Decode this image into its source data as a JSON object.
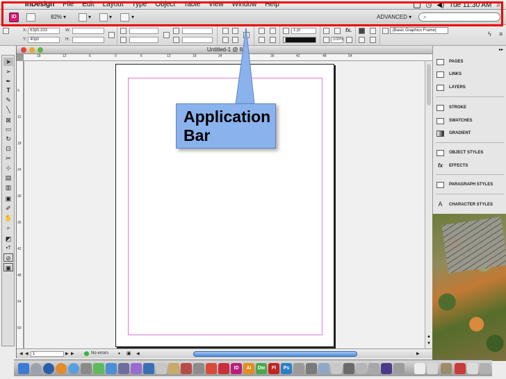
{
  "menubar": {
    "apple": "",
    "app_name": "InDesign",
    "menus": [
      "File",
      "Edit",
      "Layout",
      "Type",
      "Object",
      "Table",
      "View",
      "Window",
      "Help"
    ],
    "clock": "Tue 11:30 AM",
    "search_icon": "spotlight-icon"
  },
  "appbar": {
    "logo": "ID",
    "zoom": "82%",
    "workspace": "ADVANCED ▾",
    "search_placeholder": "⌕"
  },
  "controlbar": {
    "x_label": "X:",
    "x_value": "63p5.333",
    "y_label": "Y:",
    "y_value": "40p0",
    "w_label": "W:",
    "h_label": "H:",
    "stroke_weight": "1 pt",
    "scale": "100%",
    "frame_style": "[Basic Graphics Frame]"
  },
  "document": {
    "title": "Untitled-1 @ 8",
    "ruler_top": [
      "18",
      "12",
      "6",
      "0",
      "6",
      "12",
      "18",
      "24",
      "30",
      "36",
      "42",
      "48",
      "54"
    ],
    "ruler_left": [
      "6",
      "12",
      "18",
      "24",
      "30",
      "36",
      "42",
      "48",
      "54",
      "60"
    ],
    "page_number": "1",
    "status": "No errors"
  },
  "panels": {
    "items": [
      "PAGES",
      "LINKS",
      "LAYERS",
      "STROKE",
      "SWATCHES",
      "GRADIENT",
      "OBJECT STYLES",
      "EFFECTS",
      "PARAGRAPH STYLES",
      "CHARACTER STYLES"
    ]
  },
  "callout": {
    "line1": "Application",
    "line2": "Bar"
  },
  "dock": {
    "apps": [
      "ID",
      "Ai",
      "Dw",
      "Fl",
      "Ps"
    ]
  },
  "colors": {
    "highlight": "#e00000",
    "callout_fill": "#8ab3ee",
    "margin_guide": "#e07ad8"
  }
}
